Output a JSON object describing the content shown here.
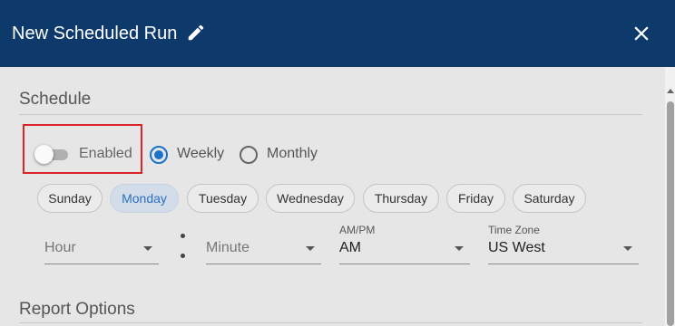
{
  "dialog": {
    "title": "New Scheduled Run"
  },
  "header_icons": {
    "edit": "pencil-icon",
    "close": "close-icon"
  },
  "schedule": {
    "section_title": "Schedule",
    "enabled_label": "Enabled",
    "enabled": false,
    "frequency_options": [
      {
        "label": "Weekly",
        "selected": true
      },
      {
        "label": "Monthly",
        "selected": false
      }
    ],
    "days": [
      {
        "label": "Sunday",
        "selected": false
      },
      {
        "label": "Monday",
        "selected": true
      },
      {
        "label": "Tuesday",
        "selected": false
      },
      {
        "label": "Wednesday",
        "selected": false
      },
      {
        "label": "Thursday",
        "selected": false
      },
      {
        "label": "Friday",
        "selected": false
      },
      {
        "label": "Saturday",
        "selected": false
      }
    ],
    "hour": {
      "placeholder": "Hour",
      "value": ""
    },
    "minute": {
      "placeholder": "Minute",
      "value": ""
    },
    "ampm": {
      "label": "AM/PM",
      "value": "AM"
    },
    "timezone": {
      "label": "Time Zone",
      "value": "US West"
    }
  },
  "report_options": {
    "section_title": "Report Options"
  },
  "colors": {
    "header": "#0e3a6b",
    "accent": "#1a73c8",
    "highlight": "#d9252a",
    "selected_chip": "#d3dde9"
  }
}
